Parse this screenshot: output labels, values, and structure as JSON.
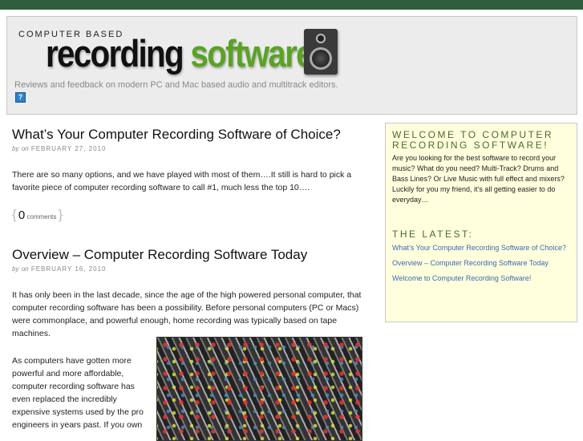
{
  "header": {
    "kicker": "COMPUTER BASED",
    "logo_word1": "recording",
    "logo_word2": "software",
    "tagline": "Reviews and feedback on modern PC and Mac based audio and multitrack editors.",
    "icon_glyph": "?"
  },
  "posts": [
    {
      "title": "What’s Your Computer Recording Software of Choice?",
      "by": "by",
      "on": "on",
      "date": "FEBRUARY 27, 2010",
      "body": "There are so many options, and we have played with most of them….It still is hard to pick a favorite piece of computer recording software to call #1, much less the top 10….",
      "comment_count": "0",
      "comments_label": "comments"
    },
    {
      "title": "Overview – Computer Recording Software Today",
      "by": "by",
      "on": "on",
      "date": "FEBRUARY 16, 2010",
      "body": "It has only been in the last decade, since the age of the high powered personal computer, that computer recording software has been a possibility.  Before personal computers (PC or Macs) were commonplace, and powerful enough, home recording was typically based on tape machines.",
      "body2": "As computers have gotten more powerful and more affordable, computer recording software has even replaced the incredibly expensive systems used by the pro engineers in years past.  If you own"
    }
  ],
  "sidebar": {
    "welcome_title": "WELCOME TO COMPUTER RECORDING SOFTWARE!",
    "welcome_text": "Are you looking for the best software to record your music? What do you need? Multi-Track? Drums and Bass Lines? Or Live Music with full effect and mixers? Luckily for you my friend, it’s all getting easier to do everyday…",
    "latest_title": "THE LATEST:",
    "latest": [
      "What’s Your Computer Recording Software of Choice?",
      "Overview – Computer Recording Software Today",
      "Welcome to Computer Recording Software!"
    ]
  },
  "colors": {
    "topbar": "#2f5e3d",
    "logo_green": "#5aa224",
    "sidebar_bg": "#ffffdd",
    "link": "#3a6ab0"
  }
}
